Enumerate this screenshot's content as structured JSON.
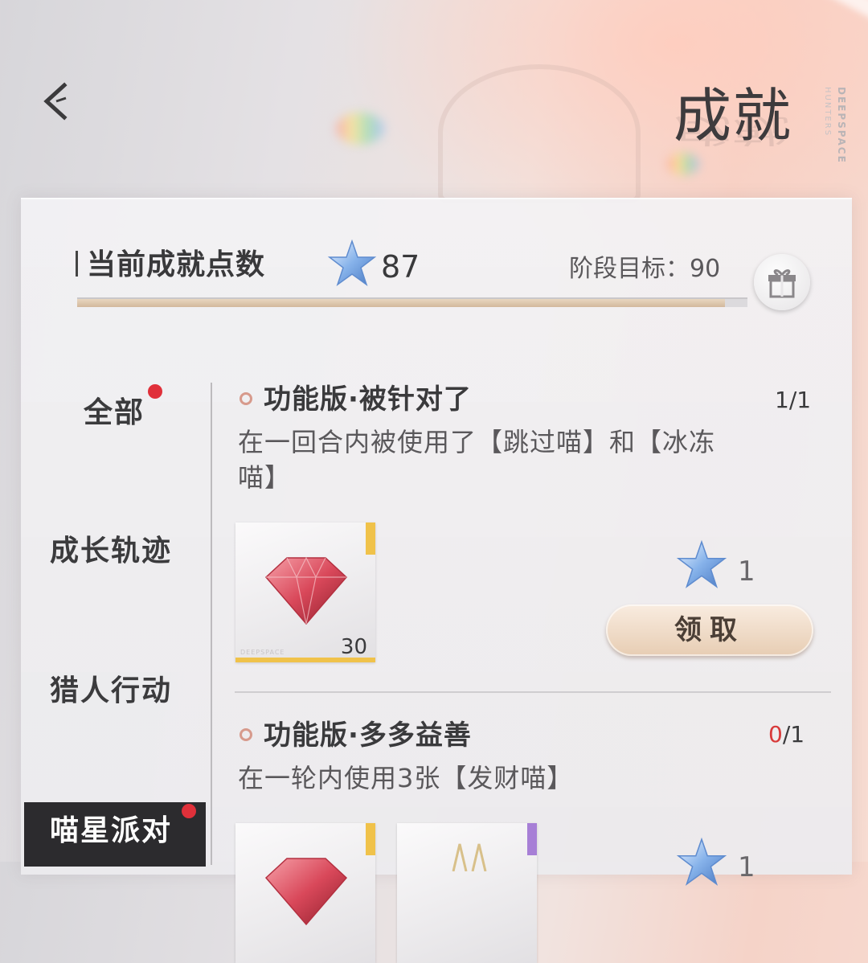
{
  "header": {
    "title": "成就",
    "brand_line1": "DEEPSPACE",
    "brand_line2": "HUNTERS"
  },
  "points": {
    "label": "当前成就点数",
    "value": "87",
    "goal_text": "阶段目标：90",
    "progress_fraction": 0.967
  },
  "sidebar": {
    "items": [
      {
        "label": "全部",
        "has_dot": true,
        "active": false
      },
      {
        "label": "成长轨迹",
        "has_dot": false,
        "active": false
      },
      {
        "label": "猎人行动",
        "has_dot": false,
        "active": false
      },
      {
        "label": "喵星派对",
        "has_dot": true,
        "active": true
      }
    ]
  },
  "achievements": [
    {
      "title": "功能版·被针对了",
      "count_done": "1",
      "count_total": "/1",
      "desc_line1": "在一回合内被使用了【跳过喵】和【冰冻",
      "desc_line2": "喵】",
      "reward_qty": "30",
      "reward_brand": "DEEPSPACE",
      "points": "1",
      "claim_label": "领取"
    },
    {
      "title": "功能版·多多益善",
      "count_done": "0",
      "count_total": "/1",
      "desc_line1": "在一轮内使用3张【发财喵】",
      "points": "1"
    }
  ],
  "colors": {
    "accent_red": "#e0303a",
    "claim_button": "#e7cdb3",
    "rarity_gold": "#f0c24a",
    "rarity_purple": "#a77fd6"
  },
  "icons": [
    "back-chevron-icon",
    "star-icon",
    "gift-icon",
    "gem-icon",
    "trophy-icon"
  ]
}
